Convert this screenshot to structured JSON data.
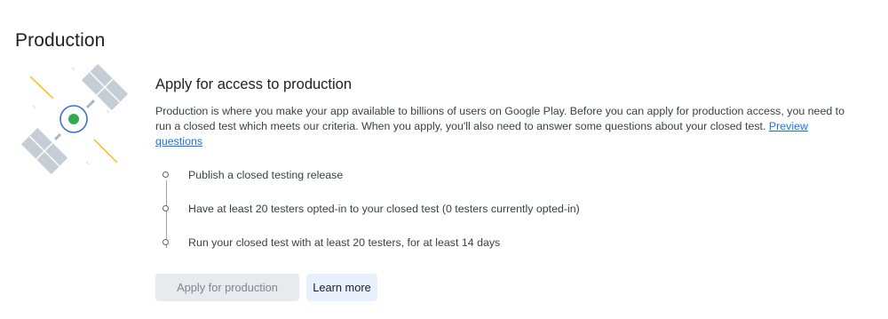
{
  "page": {
    "title": "Production"
  },
  "illustration": {
    "icon": "satellite-icon",
    "colors": {
      "panel": "#c5cdd6",
      "panel_dark": "#a9b4c0",
      "ring": "#3b6fd4",
      "core": "#34a853",
      "signal": "#f4c430"
    }
  },
  "section": {
    "heading": "Apply for access to production",
    "description": "Production is where you make your app available to billions of users on Google Play. Before you can apply for production access, you need to run a closed test which meets our criteria. When you apply, you'll also need to answer some questions about your closed test.",
    "link_label": "Preview questions"
  },
  "steps": [
    {
      "label": "Publish a closed testing release"
    },
    {
      "label": "Have at least 20 testers opted-in to your closed test (0 testers currently opted-in)"
    },
    {
      "label": "Run your closed test with at least 20 testers, for at least 14 days"
    }
  ],
  "actions": {
    "apply_label": "Apply for production",
    "learn_more_label": "Learn more"
  },
  "colors": {
    "link": "#1a73e8",
    "disabled_button_bg": "#e8eaed",
    "secondary_button_bg": "#e8f0fe"
  }
}
